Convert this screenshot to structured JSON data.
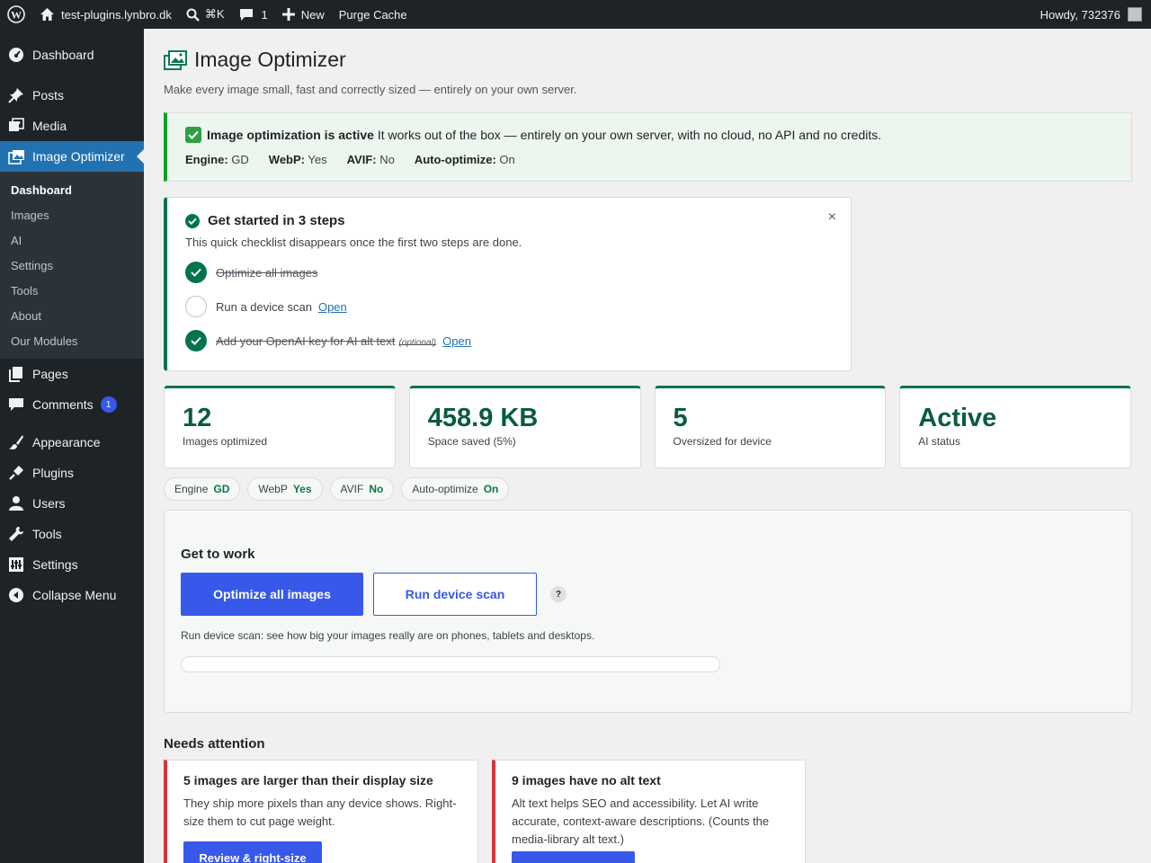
{
  "adminbar": {
    "site_name": "test-plugins.lynbro.dk",
    "shortcut": "⌘K",
    "comments_count": "1",
    "new_label": "New",
    "purge_label": "Purge Cache",
    "howdy": "Howdy, 732376"
  },
  "sidebar": {
    "dashboard": "Dashboard",
    "posts": "Posts",
    "media": "Media",
    "image_optimizer": "Image Optimizer",
    "submenu": [
      "Dashboard",
      "Images",
      "AI",
      "Settings",
      "Tools",
      "About",
      "Our Modules"
    ],
    "pages": "Pages",
    "comments": "Comments",
    "comments_badge": "1",
    "appearance": "Appearance",
    "plugins": "Plugins",
    "users": "Users",
    "tools": "Tools",
    "settings": "Settings",
    "collapse": "Collapse Menu"
  },
  "page": {
    "title": "Image Optimizer",
    "subtitle": "Make every image small, fast and correctly sized — entirely on your own server."
  },
  "notice": {
    "headline": "Image optimization is active",
    "text": " It works out of the box — entirely on your own server, with no cloud, no API and no credits.",
    "engine_label": "Engine:",
    "engine_value": " GD",
    "webp_label": "WebP:",
    "webp_value": " Yes",
    "avif_label": "AVIF:",
    "avif_value": " No",
    "auto_label": "Auto-optimize:",
    "auto_value": " On"
  },
  "checklist": {
    "title": "Get started in 3 steps",
    "close": "×",
    "description": "This quick checklist disappears once the first two steps are done.",
    "step1": "Optimize all images",
    "step2": "Run a device scan",
    "step2_link": "Open",
    "step3": "Add your OpenAI key for AI alt text",
    "step3_optional": "(optional)",
    "step3_link": "Open"
  },
  "stats": [
    {
      "value": "12",
      "label": "Images optimized"
    },
    {
      "value": "458.9 KB",
      "label": "Space saved (5%)"
    },
    {
      "value": "5",
      "label": "Oversized for device"
    },
    {
      "value": "Active",
      "label": "AI status"
    }
  ],
  "pills": [
    {
      "label": "Engine",
      "value": "GD"
    },
    {
      "label": "WebP",
      "value": "Yes"
    },
    {
      "label": "AVIF",
      "value": "No"
    },
    {
      "label": "Auto-optimize",
      "value": "On"
    }
  ],
  "work": {
    "title": "Get to work",
    "optimize_button": "Optimize all images",
    "scan_button": "Run device scan",
    "help": "?",
    "description": "Run device scan: see how big your images really are on phones, tablets and desktops.",
    "progress": 0
  },
  "attention": {
    "title": "Needs attention",
    "card1_title": "5 images are larger than their display size",
    "card1_text": "They ship more pixels than any device shows. Right-size them to cut page weight.",
    "card1_button": "Review & right-size",
    "card2_title": "9 images have no alt text",
    "card2_text": "Alt text helps SEO and accessibility. Let AI write accurate, context-aware descriptions. (Counts the media-library alt text.)",
    "card2_button": ""
  },
  "colors": {
    "accent": "#3858e9",
    "success": "#00744d",
    "danger": "#d63638",
    "admin_dark": "#1d2327"
  }
}
